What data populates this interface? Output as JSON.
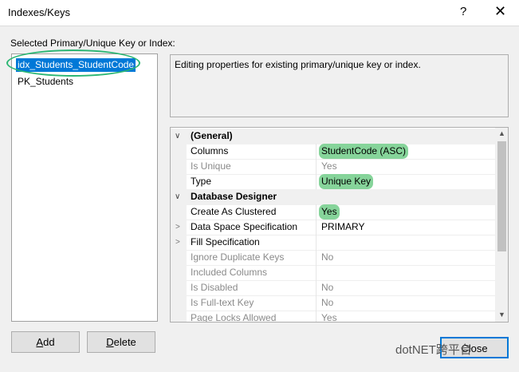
{
  "window": {
    "title": "Indexes/Keys",
    "help_glyph": "?",
    "close_glyph": "✕"
  },
  "list": {
    "label": "Selected Primary/Unique Key or Index:",
    "items": [
      {
        "label": "idx_Students_StudentCode",
        "selected": true
      },
      {
        "label": "PK_Students",
        "selected": false
      }
    ]
  },
  "description": "Editing properties for existing primary/unique key or index.",
  "properties": {
    "categories": [
      {
        "label": "(General)"
      },
      {
        "label": "Database Designer"
      }
    ],
    "rows": [
      {
        "name": "Columns",
        "value": "StudentCode (ASC)"
      },
      {
        "name": "Is Unique",
        "value": "Yes"
      },
      {
        "name": "Type",
        "value": "Unique Key"
      },
      {
        "name": "Create As Clustered",
        "value": "Yes"
      },
      {
        "name": "Data Space Specification",
        "value": "PRIMARY"
      },
      {
        "name": "Fill Specification",
        "value": ""
      },
      {
        "name": "Ignore Duplicate Keys",
        "value": "No"
      },
      {
        "name": "Included Columns",
        "value": ""
      },
      {
        "name": "Is Disabled",
        "value": "No"
      },
      {
        "name": "Is Full-text Key",
        "value": "No"
      },
      {
        "name": "Page Locks Allowed",
        "value": "Yes"
      }
    ]
  },
  "buttons": {
    "add_first": "A",
    "add_rest": "dd",
    "delete_first": "D",
    "delete_rest": "elete",
    "close": "Close"
  },
  "icons": {
    "collapse": "∨",
    "expand": ">",
    "scroll_up": "▲",
    "scroll_down": "▼"
  },
  "watermark": "dotNET跨平台",
  "colors": {
    "selection": "#0078d7",
    "highlight": "#86d49a",
    "circle": "#2bb673"
  }
}
